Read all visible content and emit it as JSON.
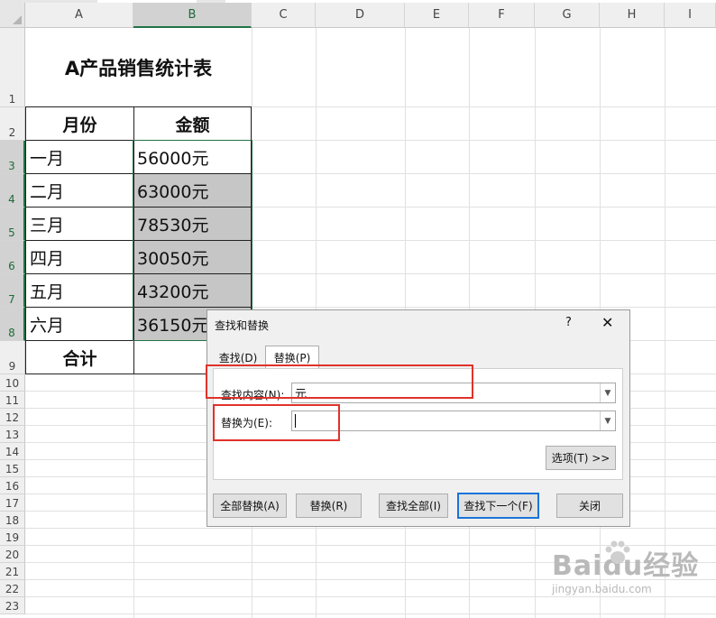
{
  "sheet": {
    "columns": [
      "A",
      "B",
      "C",
      "D",
      "E",
      "F",
      "G",
      "H",
      "I"
    ],
    "rows": [
      "1",
      "2",
      "3",
      "4",
      "5",
      "6",
      "7",
      "8",
      "9",
      "10",
      "11",
      "12",
      "13",
      "14",
      "15",
      "16",
      "17",
      "18",
      "19",
      "20",
      "21",
      "22",
      "23"
    ],
    "title": "A产品销售统计表",
    "header_month": "月份",
    "header_amount": "金额",
    "data": [
      {
        "month": "一月",
        "amount": "56000元"
      },
      {
        "month": "二月",
        "amount": "63000元"
      },
      {
        "month": "三月",
        "amount": "78530元"
      },
      {
        "month": "四月",
        "amount": "30050元"
      },
      {
        "month": "五月",
        "amount": "43200元"
      },
      {
        "month": "六月",
        "amount": "36150元"
      }
    ],
    "total_label": "合计"
  },
  "dialog": {
    "title": "查找和替换",
    "help": "?",
    "close": "✕",
    "tab_find": "查找(D)",
    "tab_replace": "替换(P)",
    "find_label": "查找内容(N):",
    "find_value": "元",
    "replace_label": "替换为(E):",
    "replace_value": "",
    "options_button": "选项(T) >>",
    "replace_all": "全部替换(A)",
    "replace": "替换(R)",
    "find_all": "查找全部(I)",
    "find_next": "查找下一个(F)",
    "close_button": "关闭",
    "dropdown_arrow": "▼"
  },
  "watermark": {
    "text": "Baidu经验",
    "url": "jingyan.baidu.com"
  },
  "colors": {
    "selection": "#217346",
    "highlight": "#e0322a",
    "focus": "#1a73d9"
  }
}
